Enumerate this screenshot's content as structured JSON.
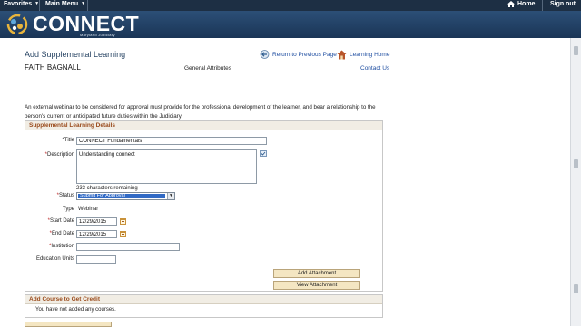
{
  "nav": {
    "favorites": "Favorites",
    "main_menu": "Main Menu",
    "home": "Home",
    "sign_out": "Sign out"
  },
  "brand": {
    "name": "CONNECT",
    "tagline": "Maryland Judiciary"
  },
  "page": {
    "title": "Add Supplemental Learning",
    "learner_name": "FAITH BAGNALL",
    "general_attributes": "General Attributes",
    "return_link": "Return to Previous Page",
    "learning_home": "Learning Home",
    "contact_us": "Contact Us",
    "intro": "An external webinar to be considered for approval must provide for the professional development of the learner, and bear a relationship to the person's current or anticipated future duties within the Judiciary."
  },
  "details": {
    "header": "Supplemental Learning Details",
    "title_label": "*Title",
    "title_value": "CONNECT Fundamentals",
    "description_label": "*Description",
    "description_value": "Understanding connect",
    "chars_remaining": "233 characters remaining",
    "status_label": "*Status",
    "status_value": "Submit For Approval",
    "type_label": "Type",
    "type_value": "Webinar",
    "start_label": "*Start Date",
    "start_value": "12/29/2015",
    "end_label": "*End Date",
    "end_value": "12/29/2015",
    "institution_label": "*Institution",
    "institution_value": "",
    "units_label": "Education Units",
    "units_value": "",
    "add_attachment": "Add Attachment",
    "view_attachment": "View Attachment"
  },
  "course_credit": {
    "header": "Add Course to Get Credit",
    "empty_text": "You have not added any courses."
  },
  "colors": {
    "nav_bg": "#1d2f44",
    "banner": "#2c4f77",
    "section_header_text": "#9a4b1c",
    "link": "#1f4ea1",
    "button": "#f4e6c2"
  },
  "icons": [
    "caret-down-icon",
    "home-icon",
    "connect-logo-icon",
    "return-arrow-icon",
    "learning-home-icon",
    "spellcheck-icon",
    "calendar-icon",
    "dropdown-arrow-icon"
  ]
}
